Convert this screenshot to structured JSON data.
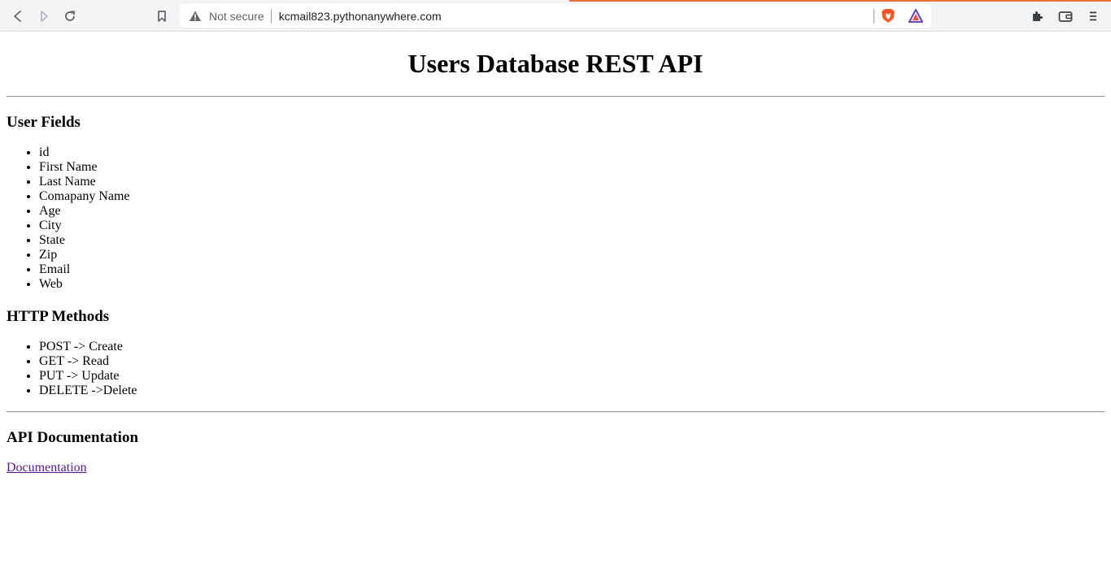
{
  "browser": {
    "address": {
      "security_label": "Not secure",
      "url": "kcmail823.pythonanywhere.com"
    },
    "icons": {
      "back": "back-arrow-icon",
      "forward": "forward-arrow-icon",
      "reload": "reload-icon",
      "bookmark": "bookmark-icon",
      "warning": "warning-triangle-icon",
      "brave_shields": "brave-lion-icon",
      "brave_rewards": "brave-rewards-triangle-icon",
      "extensions": "puzzle-piece-icon",
      "wallet": "wallet-icon",
      "menu": "hamburger-menu-icon"
    },
    "colors": {
      "chrome_background": "#f1f3f4",
      "accent": "#e8703a"
    }
  },
  "page": {
    "title": "Users Database REST API",
    "user_fields": {
      "heading": "User Fields",
      "items": [
        "id",
        "First Name",
        "Last Name",
        "Comapany Name",
        "Age",
        "City",
        "State",
        "Zip",
        "Email",
        "Web"
      ]
    },
    "http_methods": {
      "heading": "HTTP Methods",
      "items": [
        "POST -> Create",
        "GET -> Read",
        "PUT -> Update",
        "DELETE ->Delete"
      ]
    },
    "api_docs": {
      "heading": "API Documentation",
      "link_label": "Documentation"
    },
    "colors": {
      "visited_link": "#551a8b"
    }
  }
}
